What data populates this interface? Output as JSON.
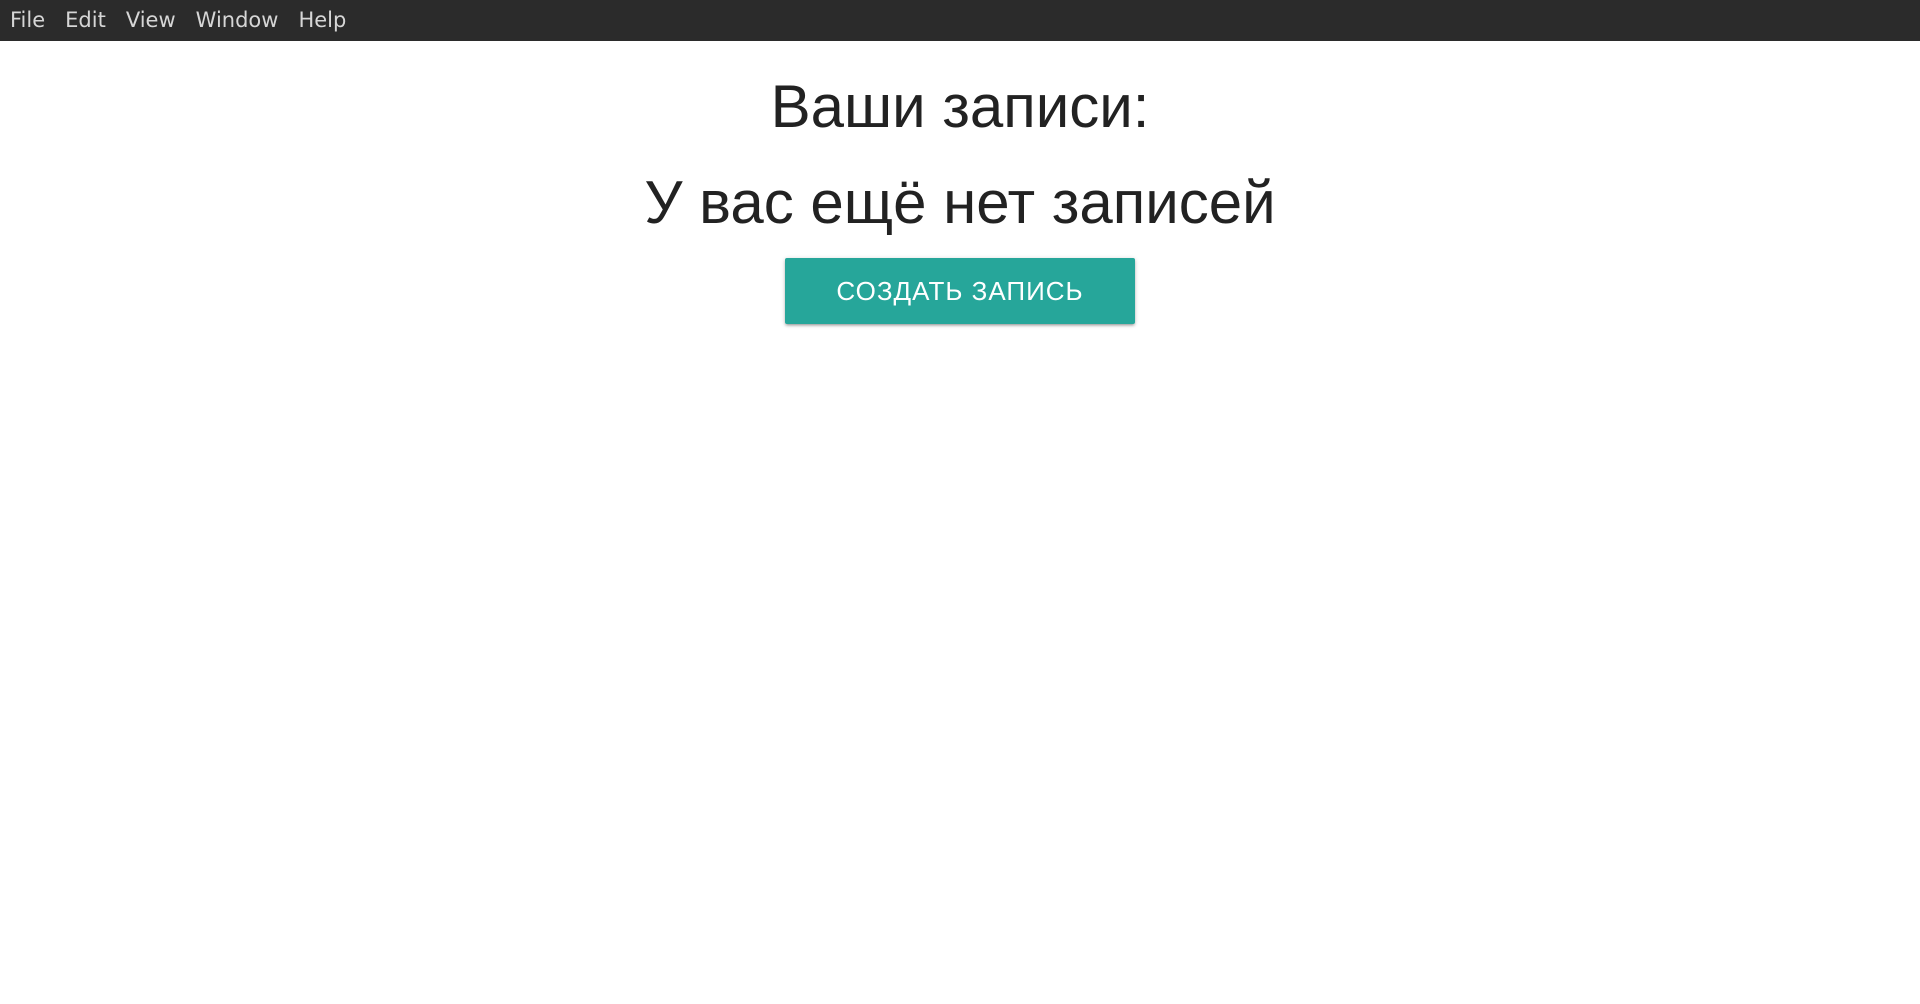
{
  "menubar": {
    "items": [
      {
        "label": "File"
      },
      {
        "label": "Edit"
      },
      {
        "label": "View"
      },
      {
        "label": "Window"
      },
      {
        "label": "Help"
      }
    ]
  },
  "main": {
    "title": "Ваши записи:",
    "empty_message": "У вас ещё нет записей",
    "create_button_label": "СОЗДАТЬ ЗАПИСЬ"
  },
  "colors": {
    "menubar_background": "#2b2b2b",
    "button_accent": "#26a69a",
    "text": "#222222"
  }
}
